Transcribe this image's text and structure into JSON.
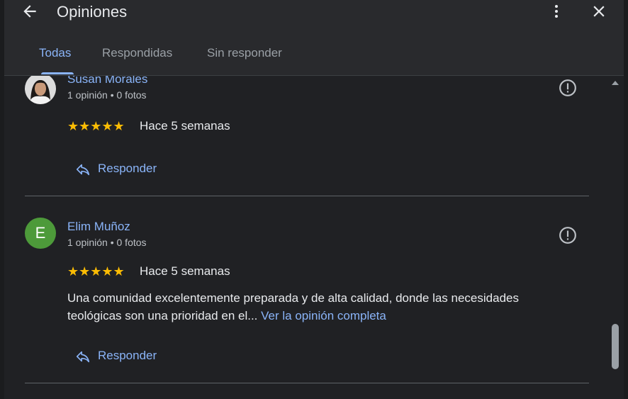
{
  "header": {
    "title": "Opiniones"
  },
  "tabs": [
    {
      "label": "Todas",
      "active": true
    },
    {
      "label": "Respondidas",
      "active": false
    },
    {
      "label": "Sin responder",
      "active": false
    }
  ],
  "reviews": [
    {
      "name": "Susan Morales",
      "meta": "1 opinión • 0 fotos",
      "stars": "★★★★★",
      "rating": 5,
      "date": "Hace 5 semanas",
      "reply_label": "Responder"
    },
    {
      "name": "Elim Muñoz",
      "avatar_letter": "E",
      "meta": "1 opinión • 0 fotos",
      "stars": "★★★★★",
      "rating": 5,
      "date": "Hace 5 semanas",
      "text": "Una comunidad excelentemente preparada y de alta calidad, donde las necesidades teológicas son una prioridad en el...",
      "more_label": "Ver la opinión completa",
      "reply_label": "Responder"
    }
  ],
  "colors": {
    "accent": "#8ab4f8",
    "star": "#fbbc04",
    "avatar_green": "#4d9a3a",
    "background": "#202124",
    "header_bg": "#292a2d"
  },
  "icons": {
    "back": "arrow-left-icon",
    "more": "more-vert-icon",
    "close": "close-icon",
    "report": "report-flag-icon",
    "reply": "reply-arrow-icon"
  },
  "scroll_position": 0.77
}
